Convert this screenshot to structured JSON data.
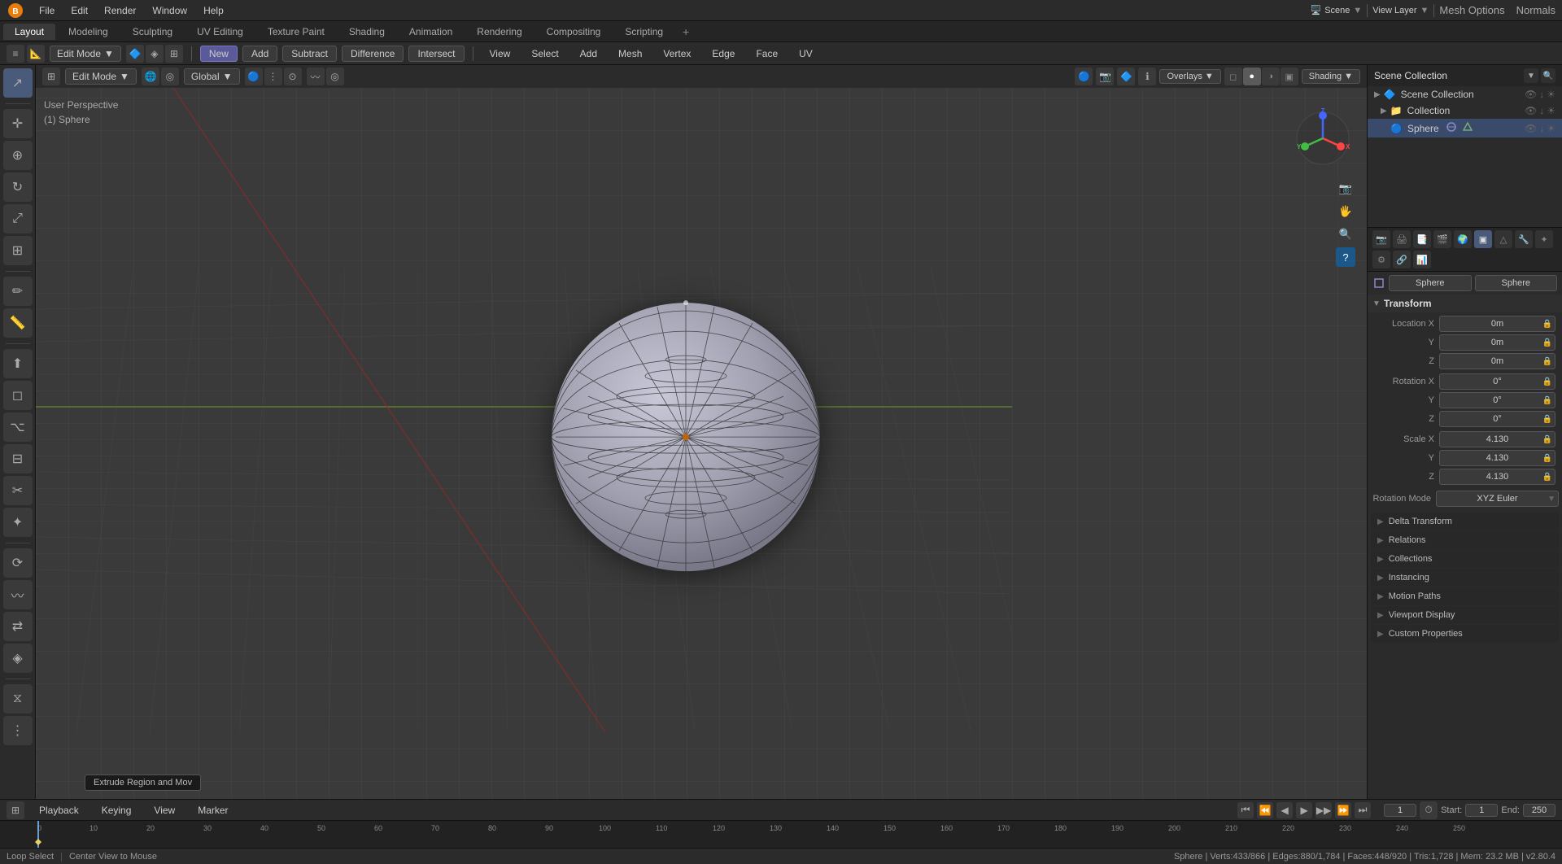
{
  "app": {
    "title": "Blender"
  },
  "top_menu": {
    "items": [
      "Blender",
      "File",
      "Edit",
      "Render",
      "Window",
      "Help"
    ]
  },
  "workspace_tabs": {
    "tabs": [
      "Layout",
      "Modeling",
      "Sculpting",
      "UV Editing",
      "Texture Paint",
      "Shading",
      "Animation",
      "Rendering",
      "Compositing",
      "Scripting"
    ],
    "active": "Layout",
    "add_label": "+"
  },
  "header_toolbar": {
    "mode_label": "Edit Mode",
    "mode_arrow": "▼",
    "buttons": [
      "New",
      "Add",
      "Subtract",
      "Difference",
      "Intersect"
    ],
    "active_btn": "New",
    "menu_items": [
      "View",
      "Select",
      "Add",
      "Mesh",
      "Vertex",
      "Edge",
      "Face",
      "UV"
    ]
  },
  "viewport": {
    "info_line1": "User Perspective",
    "info_line2": "(1) Sphere",
    "view_label": "Global",
    "mode_dropdown": "Edit Mode"
  },
  "gizmo": {
    "x_label": "X",
    "y_label": "Y",
    "z_label": "Z"
  },
  "outliner": {
    "title": "Scene Collection",
    "items": [
      {
        "label": "Scene Collection",
        "icon": "🏠",
        "indent": 0
      },
      {
        "label": "Collection",
        "icon": "📁",
        "indent": 1
      },
      {
        "label": "Sphere",
        "icon": "🔵",
        "indent": 2
      }
    ]
  },
  "properties": {
    "object_name": "Sphere",
    "section_title": "Transform",
    "location": {
      "x": "0m",
      "y": "0m",
      "z": "0m"
    },
    "rotation": {
      "x": "0°",
      "y": "0°",
      "z": "0°"
    },
    "scale": {
      "x": "4.130",
      "y": "4.130",
      "z": "4.130"
    },
    "rotation_mode_label": "Rotation Mode",
    "rotation_mode_value": "XYZ Euler",
    "collapsed_sections": [
      "Delta Transform",
      "Relations",
      "Collections",
      "Instancing",
      "Motion Paths",
      "Viewport Display",
      "Custom Properties"
    ]
  },
  "mesh_options_label": "Mesh Options",
  "normals_label": "Normals",
  "viewport_header": {
    "overlays_label": "Overlays",
    "shading_label": "Shading",
    "shading_modes": [
      "◻",
      "●",
      "◑",
      "▣"
    ]
  },
  "timeline": {
    "playback_label": "Playback",
    "keying_label": "Keying",
    "view_label": "View",
    "marker_label": "Marker",
    "frame_current": "1",
    "frame_start_label": "Start:",
    "frame_start": "1",
    "frame_end_label": "End:",
    "frame_end": "250"
  },
  "status_bar": {
    "left": "Loop Select",
    "center": "Center View to Mouse",
    "right": "Sphere | Verts:433/866 | Edges:880/1,784 | Faces:448/920 | Tris:1,728 | Mem: 23.2 MB | v2.80.4"
  },
  "tooltip": "Extrude Region and Mov"
}
